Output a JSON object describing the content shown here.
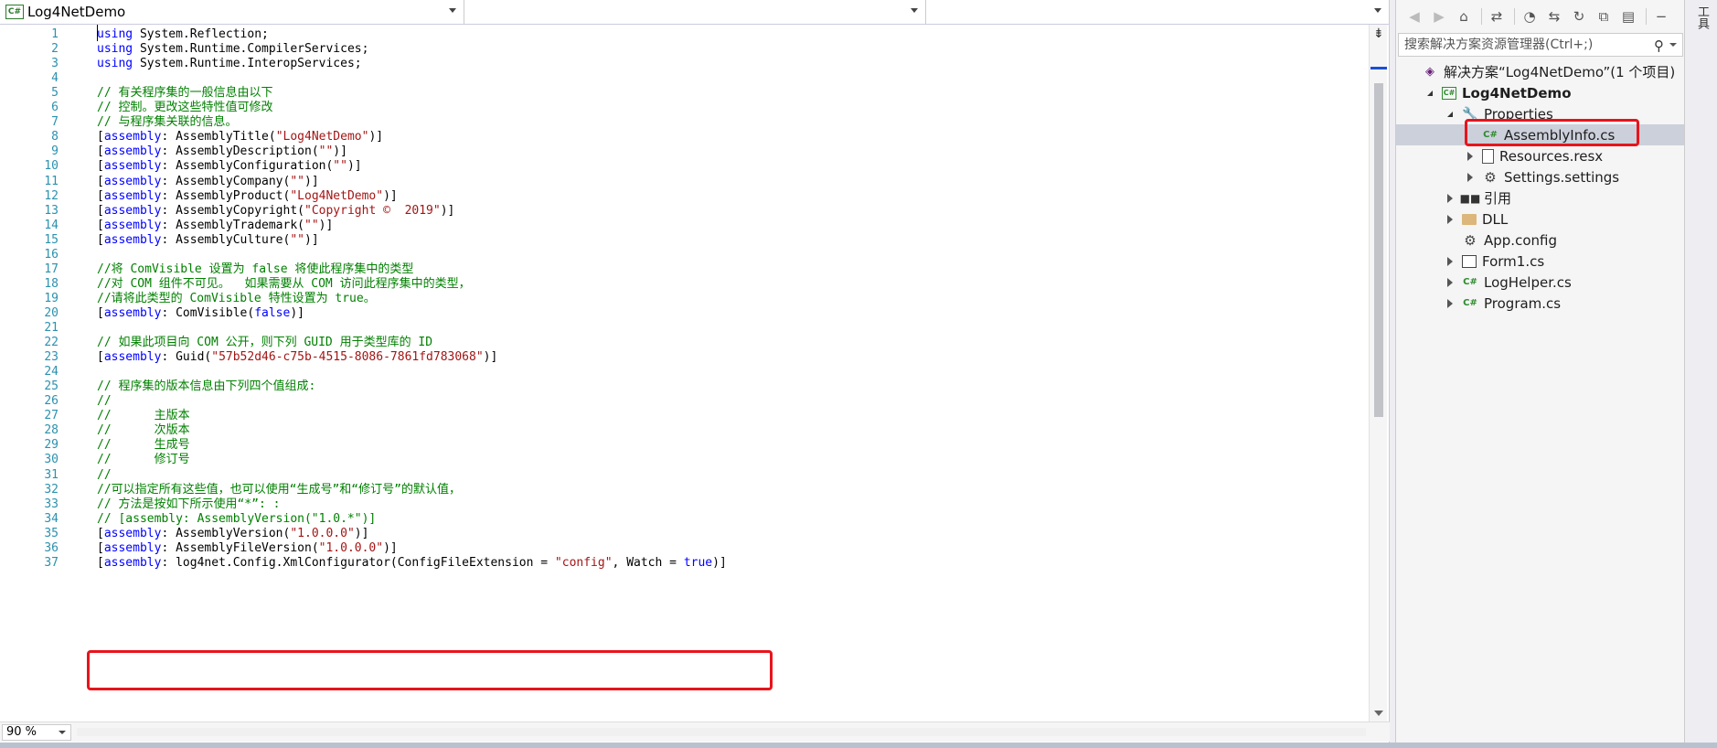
{
  "navbar": {
    "project_combo": "Log4NetDemo",
    "class_combo": "",
    "member_combo": ""
  },
  "editor": {
    "zoom": "90 %",
    "line_numbers": [
      "1",
      "2",
      "3",
      "4",
      "5",
      "6",
      "7",
      "8",
      "9",
      "10",
      "11",
      "12",
      "13",
      "14",
      "15",
      "16",
      "17",
      "18",
      "19",
      "20",
      "21",
      "22",
      "23",
      "24",
      "25",
      "26",
      "27",
      "28",
      "29",
      "30",
      "31",
      "32",
      "33",
      "34",
      "35",
      "36",
      "37"
    ],
    "lines": [
      [
        {
          "t": "using",
          "c": "kw"
        },
        {
          "t": " System.Reflection;",
          "c": ""
        }
      ],
      [
        {
          "t": "using",
          "c": "kw"
        },
        {
          "t": " System.Runtime.CompilerServices;",
          "c": ""
        }
      ],
      [
        {
          "t": "using",
          "c": "kw"
        },
        {
          "t": " System.Runtime.InteropServices;",
          "c": ""
        }
      ],
      [],
      [
        {
          "t": "// 有关程序集的一般信息由以下",
          "c": "cm"
        }
      ],
      [
        {
          "t": "// 控制。更改这些特性值可修改",
          "c": "cm"
        }
      ],
      [
        {
          "t": "// 与程序集关联的信息。",
          "c": "cm"
        }
      ],
      [
        {
          "t": "[",
          "c": ""
        },
        {
          "t": "assembly",
          "c": "kw"
        },
        {
          "t": ": AssemblyTitle(",
          "c": ""
        },
        {
          "t": "\"Log4NetDemo\"",
          "c": "st"
        },
        {
          "t": ")]",
          "c": ""
        }
      ],
      [
        {
          "t": "[",
          "c": ""
        },
        {
          "t": "assembly",
          "c": "kw"
        },
        {
          "t": ": AssemblyDescription(",
          "c": ""
        },
        {
          "t": "\"\"",
          "c": "st"
        },
        {
          "t": ")]",
          "c": ""
        }
      ],
      [
        {
          "t": "[",
          "c": ""
        },
        {
          "t": "assembly",
          "c": "kw"
        },
        {
          "t": ": AssemblyConfiguration(",
          "c": ""
        },
        {
          "t": "\"\"",
          "c": "st"
        },
        {
          "t": ")]",
          "c": ""
        }
      ],
      [
        {
          "t": "[",
          "c": ""
        },
        {
          "t": "assembly",
          "c": "kw"
        },
        {
          "t": ": AssemblyCompany(",
          "c": ""
        },
        {
          "t": "\"\"",
          "c": "st"
        },
        {
          "t": ")]",
          "c": ""
        }
      ],
      [
        {
          "t": "[",
          "c": ""
        },
        {
          "t": "assembly",
          "c": "kw"
        },
        {
          "t": ": AssemblyProduct(",
          "c": ""
        },
        {
          "t": "\"Log4NetDemo\"",
          "c": "st"
        },
        {
          "t": ")]",
          "c": ""
        }
      ],
      [
        {
          "t": "[",
          "c": ""
        },
        {
          "t": "assembly",
          "c": "kw"
        },
        {
          "t": ": AssemblyCopyright(",
          "c": ""
        },
        {
          "t": "\"Copyright ©  2019\"",
          "c": "st"
        },
        {
          "t": ")]",
          "c": ""
        }
      ],
      [
        {
          "t": "[",
          "c": ""
        },
        {
          "t": "assembly",
          "c": "kw"
        },
        {
          "t": ": AssemblyTrademark(",
          "c": ""
        },
        {
          "t": "\"\"",
          "c": "st"
        },
        {
          "t": ")]",
          "c": ""
        }
      ],
      [
        {
          "t": "[",
          "c": ""
        },
        {
          "t": "assembly",
          "c": "kw"
        },
        {
          "t": ": AssemblyCulture(",
          "c": ""
        },
        {
          "t": "\"\"",
          "c": "st"
        },
        {
          "t": ")]",
          "c": ""
        }
      ],
      [],
      [
        {
          "t": "//将 ComVisible 设置为 false 将使此程序集中的类型",
          "c": "cm"
        }
      ],
      [
        {
          "t": "//对 COM 组件不可见。  如果需要从 COM 访问此程序集中的类型，",
          "c": "cm"
        }
      ],
      [
        {
          "t": "//请将此类型的 ComVisible 特性设置为 true。",
          "c": "cm"
        }
      ],
      [
        {
          "t": "[",
          "c": ""
        },
        {
          "t": "assembly",
          "c": "kw"
        },
        {
          "t": ": ComVisible(",
          "c": ""
        },
        {
          "t": "false",
          "c": "kw"
        },
        {
          "t": ")]",
          "c": ""
        }
      ],
      [],
      [
        {
          "t": "// 如果此项目向 COM 公开，则下列 GUID 用于类型库的 ID",
          "c": "cm"
        }
      ],
      [
        {
          "t": "[",
          "c": ""
        },
        {
          "t": "assembly",
          "c": "kw"
        },
        {
          "t": ": Guid(",
          "c": ""
        },
        {
          "t": "\"57b52d46-c75b-4515-8086-7861fd783068\"",
          "c": "st"
        },
        {
          "t": ")]",
          "c": ""
        }
      ],
      [],
      [
        {
          "t": "// 程序集的版本信息由下列四个值组成:",
          "c": "cm"
        }
      ],
      [
        {
          "t": "//",
          "c": "cm"
        }
      ],
      [
        {
          "t": "//      主版本",
          "c": "cm"
        }
      ],
      [
        {
          "t": "//      次版本",
          "c": "cm"
        }
      ],
      [
        {
          "t": "//      生成号",
          "c": "cm"
        }
      ],
      [
        {
          "t": "//      修订号",
          "c": "cm"
        }
      ],
      [
        {
          "t": "//",
          "c": "cm"
        }
      ],
      [
        {
          "t": "//可以指定所有这些值，也可以使用“生成号”和“修订号”的默认值，",
          "c": "cm"
        }
      ],
      [
        {
          "t": "// 方法是按如下所示使用“*”: :",
          "c": "cm"
        }
      ],
      [
        {
          "t": "// [assembly: AssemblyVersion(\"1.0.*\")]",
          "c": "cm"
        }
      ],
      [
        {
          "t": "[",
          "c": ""
        },
        {
          "t": "assembly",
          "c": "kw"
        },
        {
          "t": ": AssemblyVersion(",
          "c": ""
        },
        {
          "t": "\"1.0.0.0\"",
          "c": "st"
        },
        {
          "t": ")]",
          "c": ""
        }
      ],
      [
        {
          "t": "[",
          "c": ""
        },
        {
          "t": "assembly",
          "c": "kw"
        },
        {
          "t": ": AssemblyFileVersion(",
          "c": ""
        },
        {
          "t": "\"1.0.0.0\"",
          "c": "st"
        },
        {
          "t": ")]",
          "c": ""
        }
      ],
      [
        {
          "t": "[",
          "c": ""
        },
        {
          "t": "assembly",
          "c": "kw"
        },
        {
          "t": ": log4net.Config.XmlConfigurator(ConfigFileExtension = ",
          "c": ""
        },
        {
          "t": "\"config\"",
          "c": "st"
        },
        {
          "t": ", Watch = ",
          "c": ""
        },
        {
          "t": "true",
          "c": "kw"
        },
        {
          "t": ")]",
          "c": ""
        }
      ]
    ]
  },
  "explorer": {
    "search_placeholder": "搜索解决方案资源管理器(Ctrl+;)",
    "tree": [
      {
        "label": "解决方案“Log4NetDemo”(1 个项目)",
        "icon": "solution-icon",
        "level": 0,
        "exp": "none",
        "selected": false
      },
      {
        "label": "Log4NetDemo",
        "icon": "csproj-icon",
        "level": 1,
        "exp": "open",
        "selected": false,
        "bold": true
      },
      {
        "label": "Properties",
        "icon": "wrench-icon",
        "level": 2,
        "exp": "open",
        "selected": false
      },
      {
        "label": "AssemblyInfo.cs",
        "icon": "cs-file-icon",
        "level": 3,
        "exp": "none",
        "selected": true
      },
      {
        "label": "Resources.resx",
        "icon": "resx-icon",
        "level": 3,
        "exp": "closed",
        "selected": false
      },
      {
        "label": "Settings.settings",
        "icon": "gear-icon",
        "level": 3,
        "exp": "closed",
        "selected": false
      },
      {
        "label": "引用",
        "icon": "references-icon",
        "level": 2,
        "exp": "closed",
        "selected": false
      },
      {
        "label": "DLL",
        "icon": "folder-icon",
        "level": 2,
        "exp": "closed",
        "selected": false
      },
      {
        "label": "App.config",
        "icon": "config-icon",
        "level": 2,
        "exp": "none",
        "selected": false
      },
      {
        "label": "Form1.cs",
        "icon": "form-icon",
        "level": 2,
        "exp": "closed",
        "selected": false
      },
      {
        "label": "LogHelper.cs",
        "icon": "cs-file-icon",
        "level": 2,
        "exp": "closed",
        "selected": false
      },
      {
        "label": "Program.cs",
        "icon": "cs-file-icon",
        "level": 2,
        "exp": "closed",
        "selected": false
      }
    ]
  },
  "right_strip_label": "工具"
}
